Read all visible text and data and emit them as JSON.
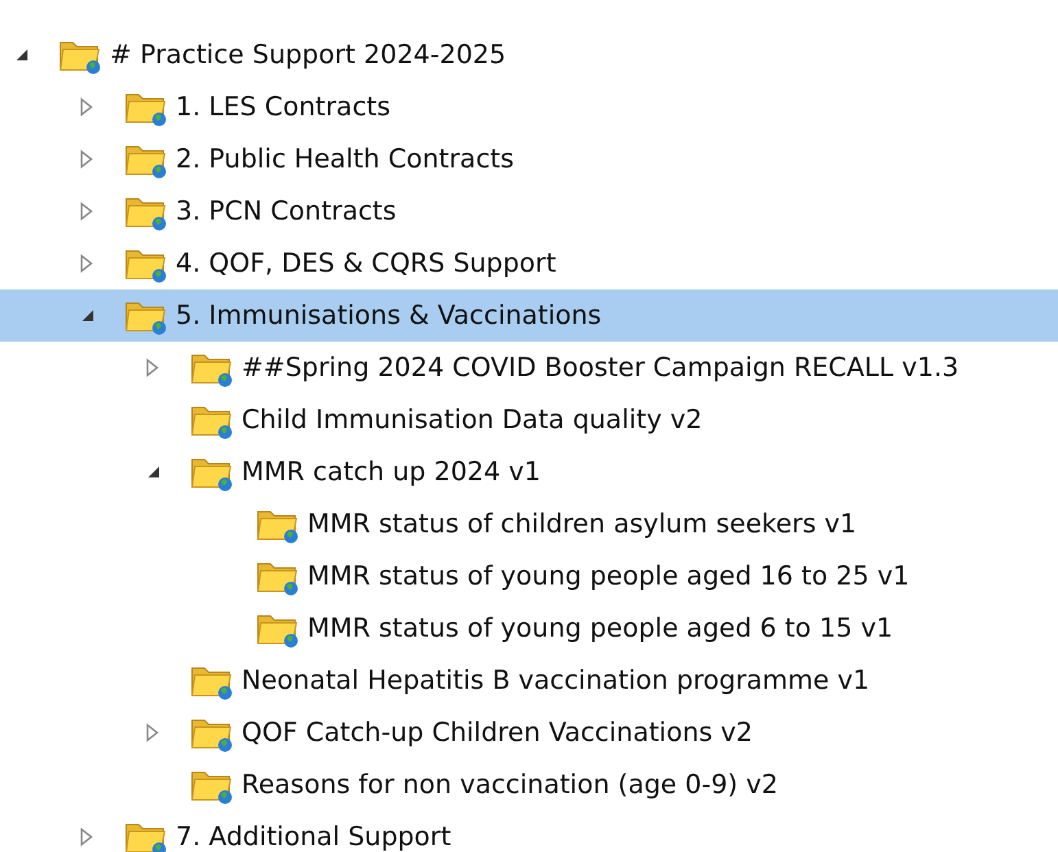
{
  "tree": [
    {
      "label": "# Practice Support 2024-2025",
      "expanded": true,
      "selected": false,
      "children": [
        {
          "label": "1. LES Contracts",
          "expanded": false,
          "selected": false
        },
        {
          "label": "2. Public Health Contracts",
          "expanded": false,
          "selected": false
        },
        {
          "label": "3. PCN Contracts",
          "expanded": false,
          "selected": false
        },
        {
          "label": "4. QOF, DES & CQRS Support",
          "expanded": false,
          "selected": false
        },
        {
          "label": "5. Immunisations & Vaccinations",
          "expanded": true,
          "selected": true,
          "children": [
            {
              "label": "##Spring 2024 COVID Booster Campaign RECALL v1.3",
              "expanded": false,
              "selected": false
            },
            {
              "label": "Child Immunisation Data quality v2",
              "selected": false
            },
            {
              "label": "MMR catch up 2024 v1",
              "expanded": true,
              "selected": false,
              "children": [
                {
                  "label": "MMR status of children asylum seekers v1",
                  "selected": false
                },
                {
                  "label": "MMR status of young people aged 16 to 25 v1",
                  "selected": false
                },
                {
                  "label": "MMR status of young people aged 6 to 15 v1",
                  "selected": false
                }
              ]
            },
            {
              "label": "Neonatal Hepatitis B vaccination programme v1",
              "selected": false
            },
            {
              "label": "QOF Catch-up Children Vaccinations v2",
              "expanded": false,
              "selected": false
            },
            {
              "label": "Reasons for non vaccination (age 0-9) v2",
              "selected": false
            }
          ]
        },
        {
          "label": "7. Additional Support",
          "expanded": false,
          "selected": false
        }
      ]
    }
  ]
}
